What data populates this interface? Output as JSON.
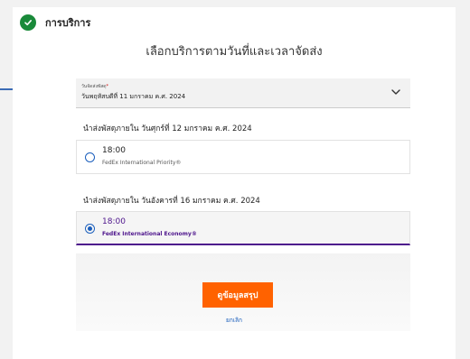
{
  "header": {
    "section_title": "การบริการ"
  },
  "main": {
    "heading": "เลือกบริการตามวันที่และเวลาจัดส่ง",
    "date_select": {
      "label": "วันจัดส่งพัสดุ",
      "required_mark": "*",
      "value": "วันพฤหัสบดีที่ 11 มกราคม ค.ศ. 2024"
    },
    "groups": [
      {
        "title": "นำส่งพัสดุภายใน วันศุกร์ที่ 12 มกราคม ค.ศ. 2024",
        "options": [
          {
            "time": "18:00",
            "service": "FedEx International Priority®",
            "selected": false
          }
        ]
      },
      {
        "title": "นำส่งพัสดุภายใน วันอังคารที่ 16 มกราคม ค.ศ. 2024",
        "options": [
          {
            "time": "18:00",
            "service": "FedEx International Economy®",
            "selected": true
          }
        ]
      }
    ],
    "primary_button": "ดูข้อมูลสรุป",
    "cancel_link": "ยกเลิก"
  },
  "colors": {
    "accent_orange": "#ff6200",
    "fedex_purple": "#4d148c",
    "link_blue": "#1a5ebc",
    "check_green": "#1a8a3a"
  },
  "icons": [
    "check-circle-icon",
    "chevron-down-icon",
    "radio-icon"
  ]
}
